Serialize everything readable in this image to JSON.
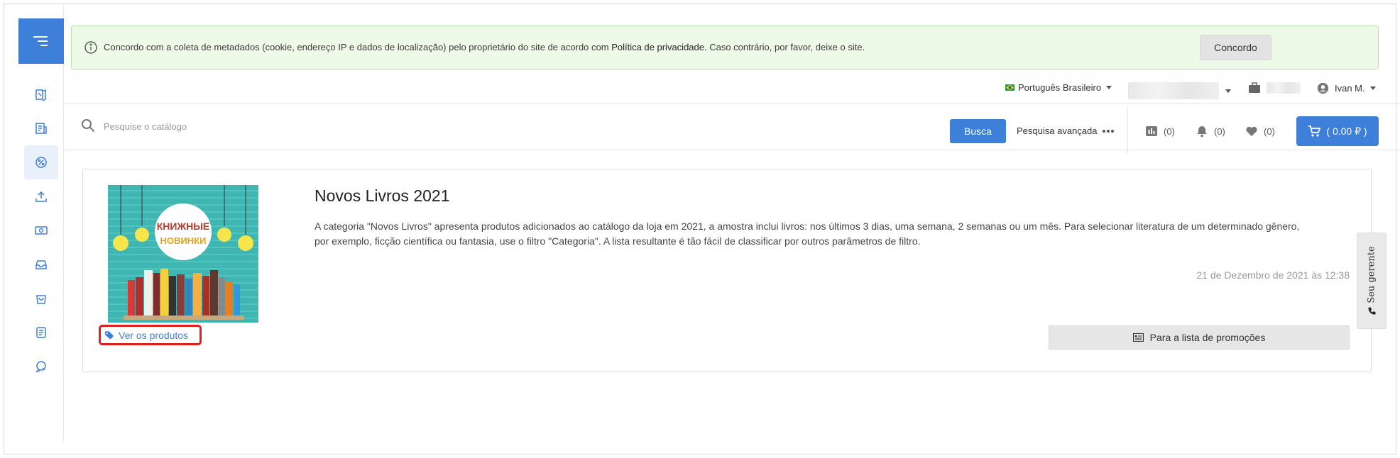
{
  "sidebar": {
    "items": [
      {
        "icon": "book-icon"
      },
      {
        "icon": "orders-icon"
      },
      {
        "icon": "discount-icon",
        "active": true
      },
      {
        "icon": "upload-icon"
      },
      {
        "icon": "cash-icon"
      },
      {
        "icon": "inbox-icon"
      },
      {
        "icon": "shopping-bag-icon"
      },
      {
        "icon": "document-icon"
      },
      {
        "icon": "chat-icon"
      }
    ]
  },
  "banner": {
    "text_before": "Concordo com a coleta de metadados (cookie, endereço IP e dados de localização) pelo proprietário do site de acordo com ",
    "link": "Política de privacidade",
    "text_after": ". Caso contrário, por favor, deixe o site.",
    "button": "Concordo"
  },
  "topbar": {
    "language": "Português Brasileiro",
    "user": "Ivan M."
  },
  "search": {
    "placeholder": "Pesquise o catálogo",
    "button": "Busca",
    "advanced": "Pesquisa avançada"
  },
  "counters": {
    "compare": "(0)",
    "notifications": "(0)",
    "wishlist": "(0)",
    "cart": "( 0.00 ₽ )"
  },
  "promo": {
    "title": "Novos Livros 2021",
    "description": "A categoria \"Novos Livros\" apresenta produtos adicionados ao catálogo da loja em 2021, a amostra inclui livros: nos últimos 3 dias, uma semana, 2 semanas ou um mês. Para selecionar literatura de um determinado gênero, por exemplo, ficção científica ou fantasia, use o filtro \"Categoria\". A lista resultante é tão fácil de classificar por outros parâmetros de filtro.",
    "date": "21 de Dezembro de 2021 às 12:38",
    "image_text_line1": "КНИЖНЫЕ",
    "image_text_line2": "НОВИНКИ",
    "view_products": "Ver os produtos",
    "list_button": "Para a lista de promoções"
  },
  "side_tab": {
    "label": "Seu gerente"
  },
  "colors": {
    "accent": "#3d7fd9",
    "banner_bg": "#eefae8",
    "highlight_border": "#e0201c"
  }
}
